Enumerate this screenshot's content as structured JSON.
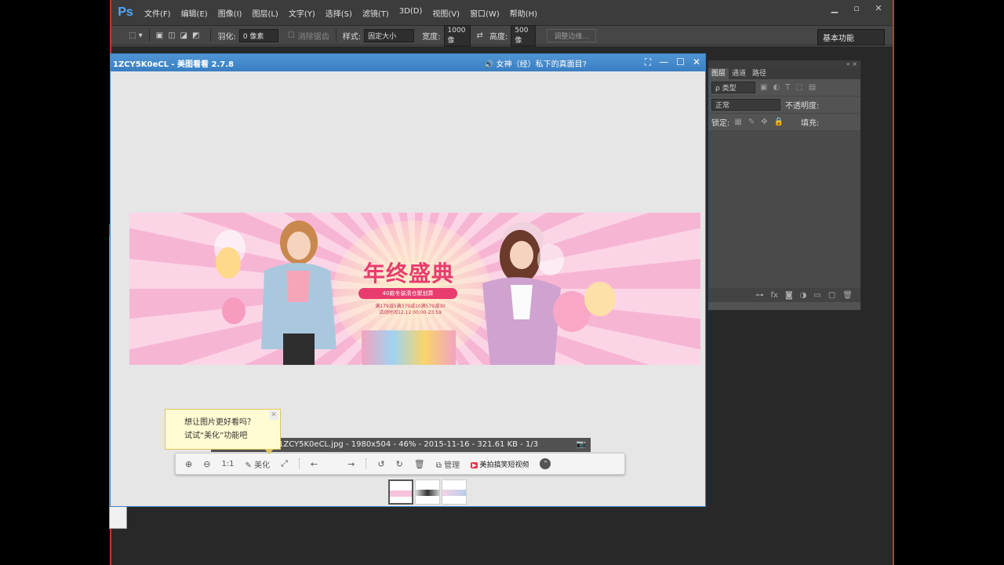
{
  "photoshop": {
    "logo": "Ps",
    "menu": [
      "文件(F)",
      "编辑(E)",
      "图像(I)",
      "图层(L)",
      "文字(Y)",
      "选择(S)",
      "滤镜(T)",
      "3D(D)",
      "视图(V)",
      "窗口(W)",
      "帮助(H)"
    ],
    "options": {
      "feather_label": "羽化:",
      "feather_value": "0 像素",
      "antialias_label": "消除锯齿",
      "style_label": "样式:",
      "style_value": "固定大小",
      "width_label": "宽度:",
      "width_value": "1000 像",
      "height_label": "高度:",
      "height_value": "500 像",
      "refine_edge": "调整边缘...",
      "workspace": "基本功能"
    },
    "layers_panel": {
      "tabs": [
        "图层",
        "通道",
        "路径"
      ],
      "kind": "ρ 类型",
      "blend_mode": "正常",
      "opacity_label": "不透明度:",
      "lock_label": "锁定:",
      "fill_label": "填充:"
    }
  },
  "viewer": {
    "title": "1ZCY5K0eCL - 美图看看 2.7.8",
    "ad_text": "女神（经）私下的真面目?",
    "banner": {
      "headline": "年终盛典",
      "subline": "40款冬装清仓聚划算",
      "promo": [
        "满179减5满379减10满579减30",
        "活动时间12.12 00:00-23:59"
      ]
    },
    "info_bar": "1ZCY5K0eCL.jpg - 1980x504 - 46% - 2015-11-16 - 321.61 KB - 1/3",
    "toolbar": {
      "actual_size": "1:1",
      "beautify": "美化",
      "manage": "管理",
      "meipai": "美拍搞笑短视频"
    },
    "tooltip": {
      "line1": "想让图片更好看吗？",
      "line2": "试试“美化”功能吧"
    }
  },
  "colors": {
    "ps_menubar": "#3c3c3c",
    "viewer_title": "#3a7fc2",
    "banner_pink": "#f7b5d4",
    "headline": "#e83c6e"
  }
}
